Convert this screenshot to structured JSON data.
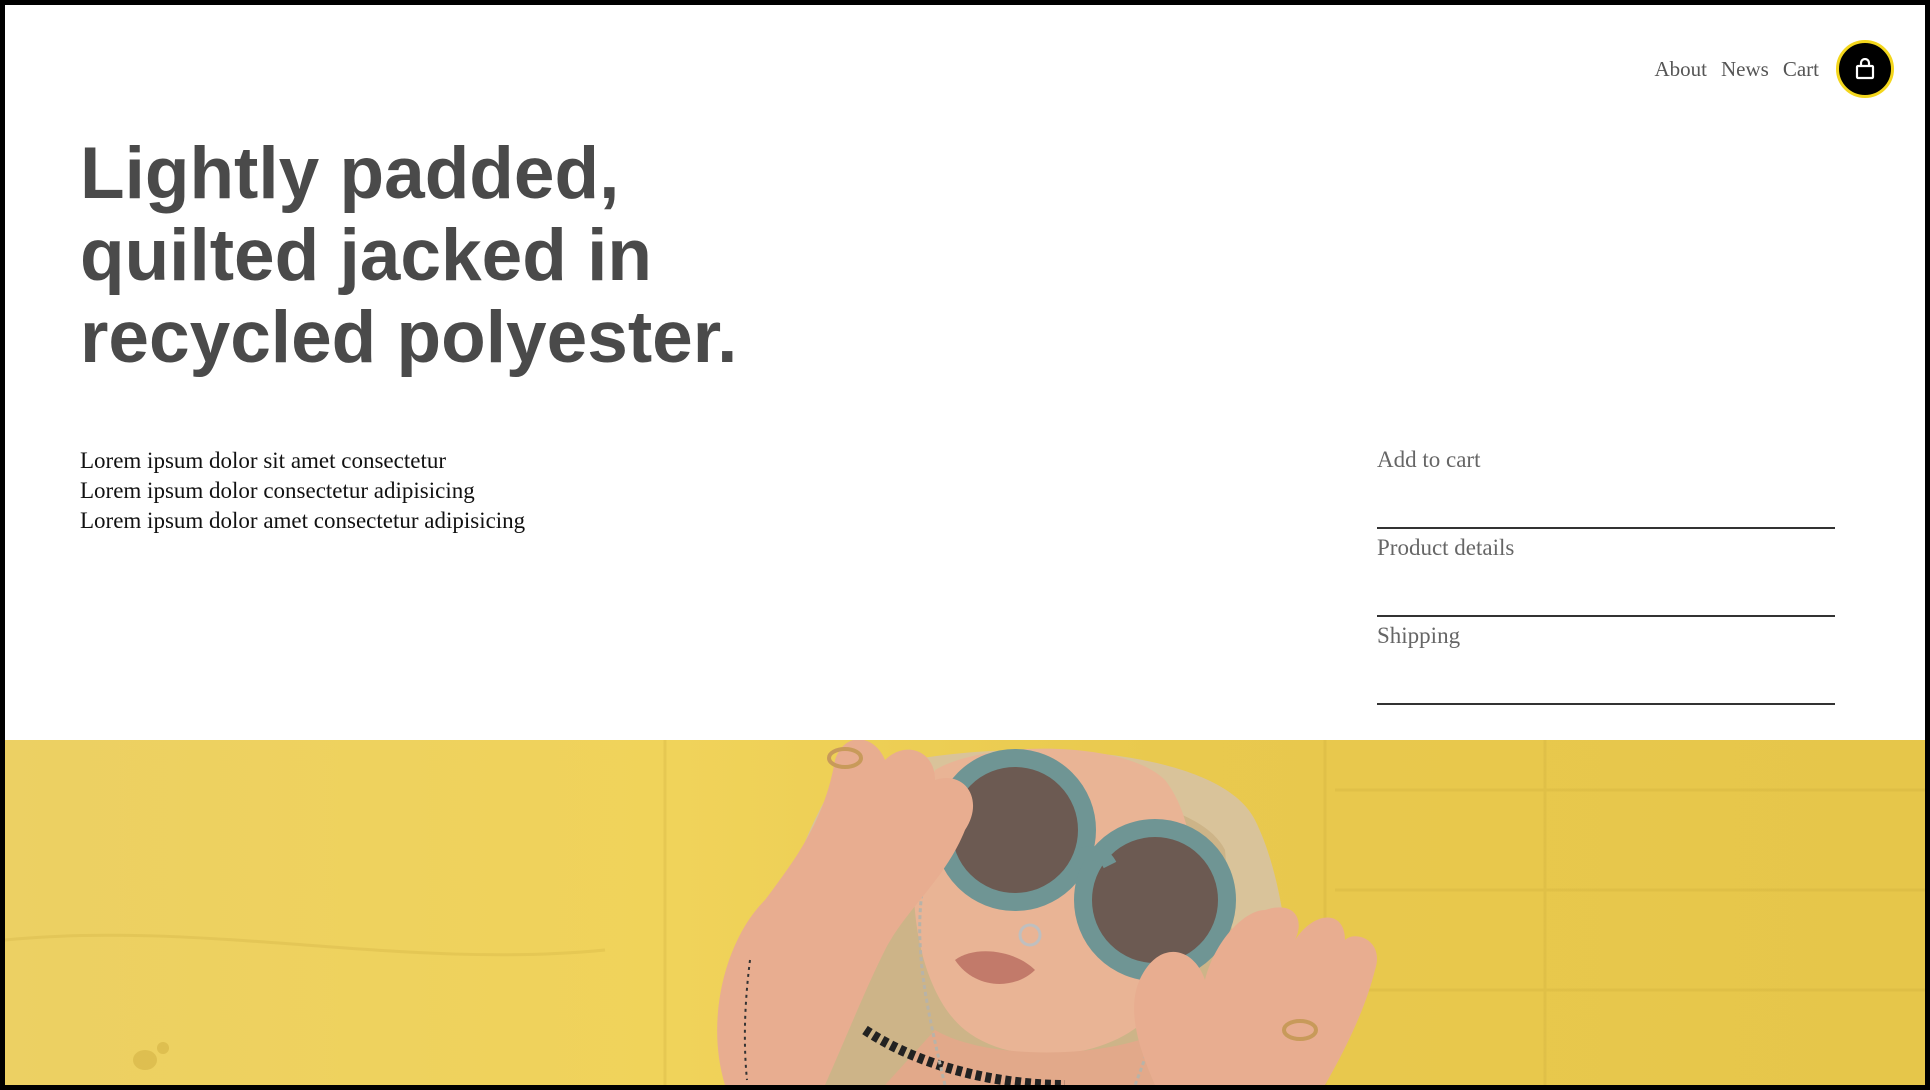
{
  "nav": {
    "items": [
      {
        "label": "About"
      },
      {
        "label": "News"
      },
      {
        "label": "Cart"
      }
    ],
    "bag_icon": "shopping-bag-icon"
  },
  "hero_text": {
    "title_lines": [
      "Lightly padded,",
      "quilted jacked in",
      "recycled polyester."
    ]
  },
  "description": {
    "lines": [
      "Lorem ipsum dolor sit amet consectetur",
      "Lorem ipsum dolor consectetur adipisicing",
      "Lorem ipsum dolor amet consectetur adipisicing"
    ]
  },
  "accordion": {
    "items": [
      {
        "label": "Add to cart"
      },
      {
        "label": "Product details"
      },
      {
        "label": "Shipping"
      }
    ]
  },
  "colors": {
    "accent": "#f3d61c",
    "heading": "#4a4a4a",
    "hero_background": "#f0d35a"
  }
}
